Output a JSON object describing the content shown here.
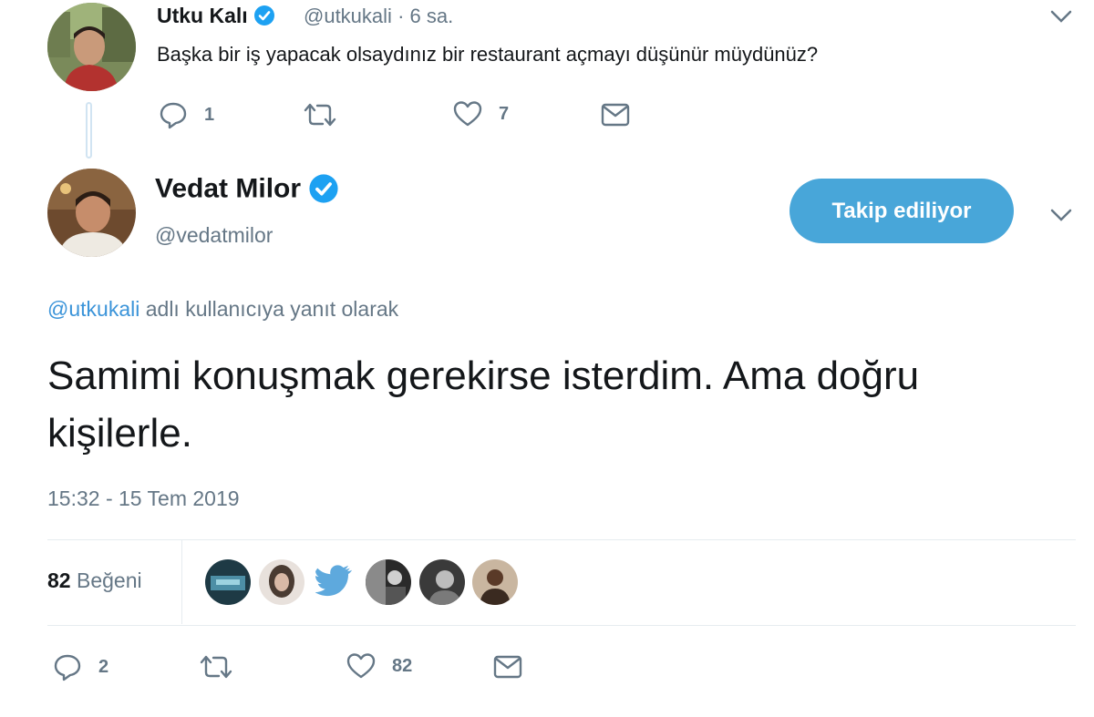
{
  "parent_tweet": {
    "name": "Utku Kalı",
    "handle": "@utkukali",
    "time": "· 6 sa.",
    "text": "Başka bir iş yapacak olsaydınız bir restaurant açmayı düşünür müydünüz?",
    "actions": {
      "reply_count": "1",
      "retweet_count": "",
      "like_count": "7"
    }
  },
  "main_tweet": {
    "name": "Vedat Milor",
    "handle": "@vedatmilor",
    "follow_button": "Takip ediliyor",
    "reply_to": {
      "mention": "@utkukali",
      "suffix": " adlı kullanıcıya yanıt olarak"
    },
    "text": "Samimi konuşmak gerekirse isterdim. Ama doğru kişilerle.",
    "timestamp": "15:32 - 15 Tem 2019",
    "likes": {
      "count": "82",
      "label": "Beğeni"
    },
    "actions": {
      "reply_count": "2",
      "retweet_count": "",
      "like_count": "82"
    }
  },
  "colors": {
    "accent": "#48a6d9",
    "link": "#3b94d9",
    "verified": "#1da1f2",
    "muted": "#657786",
    "text": "#14171a"
  },
  "icons": [
    "reply-icon",
    "retweet-icon",
    "like-icon",
    "dm-icon",
    "verified-icon",
    "chevron-down-icon"
  ]
}
